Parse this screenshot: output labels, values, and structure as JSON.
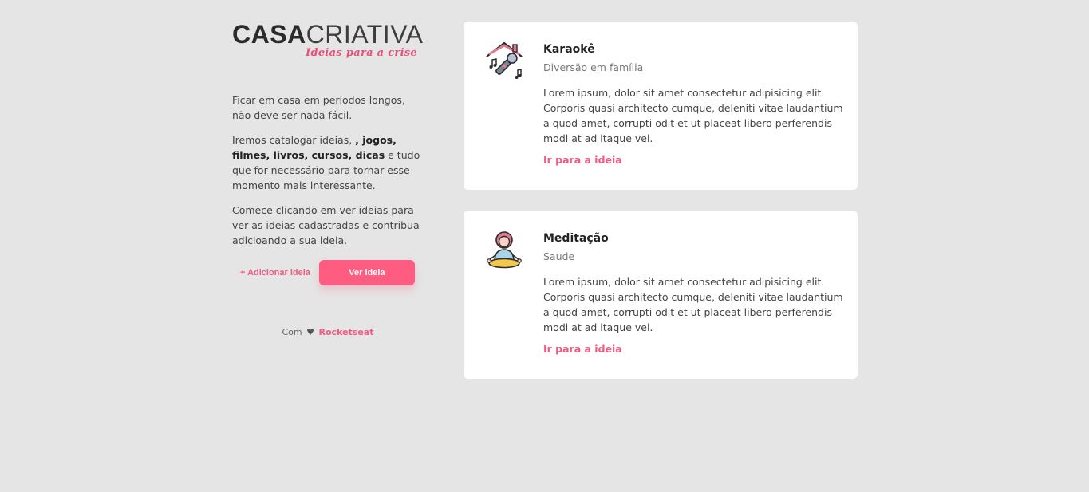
{
  "logo": {
    "part1": "CASA",
    "part2": "CRIATIVA",
    "tagline": "Ideias para a crise"
  },
  "intro": {
    "p1": "Ficar em casa em períodos longos, não deve ser nada fácil.",
    "p2_start": "Iremos catalogar ideias, ",
    "p2_bold": ", jogos, filmes, livros, cursos, dicas",
    "p2_end": " e tudo que for necessário para tornar esse momento mais interessante.",
    "p3": "Comece clicando em ver ideias para ver as ideias cadastradas e contribua adicioando a sua ideia."
  },
  "actions": {
    "add_label": "+ Adicionar ideia",
    "view_label": "Ver ideia"
  },
  "credit": {
    "prefix": "Com",
    "heart": "♥",
    "brand": "Rocketseat"
  },
  "cards": [
    {
      "icon": "karaoke-house-microphone-icon",
      "title": "Karaokê",
      "category": "Diversão em família",
      "description": "Lorem ipsum, dolor sit amet consectetur adipisicing elit. Corporis quasi architecto cumque, deleniti vitae laudantium a quod amet, corrupti odit et ut placeat libero perferendis modi at ad itaque vel.",
      "link": "Ir para a ideia"
    },
    {
      "icon": "meditation-person-icon",
      "title": "Meditação",
      "category": "Saude",
      "description": "Lorem ipsum, dolor sit amet consectetur adipisicing elit. Corporis quasi architecto cumque, deleniti vitae laudantium a quod amet, corrupti odit et ut placeat libero perferendis modi at ad itaque vel.",
      "link": "Ir para a ideia"
    }
  ],
  "colors": {
    "background": "#e5e5e5",
    "accent": "#ff5c82",
    "link": "#ef5b80",
    "card": "#ffffff"
  }
}
